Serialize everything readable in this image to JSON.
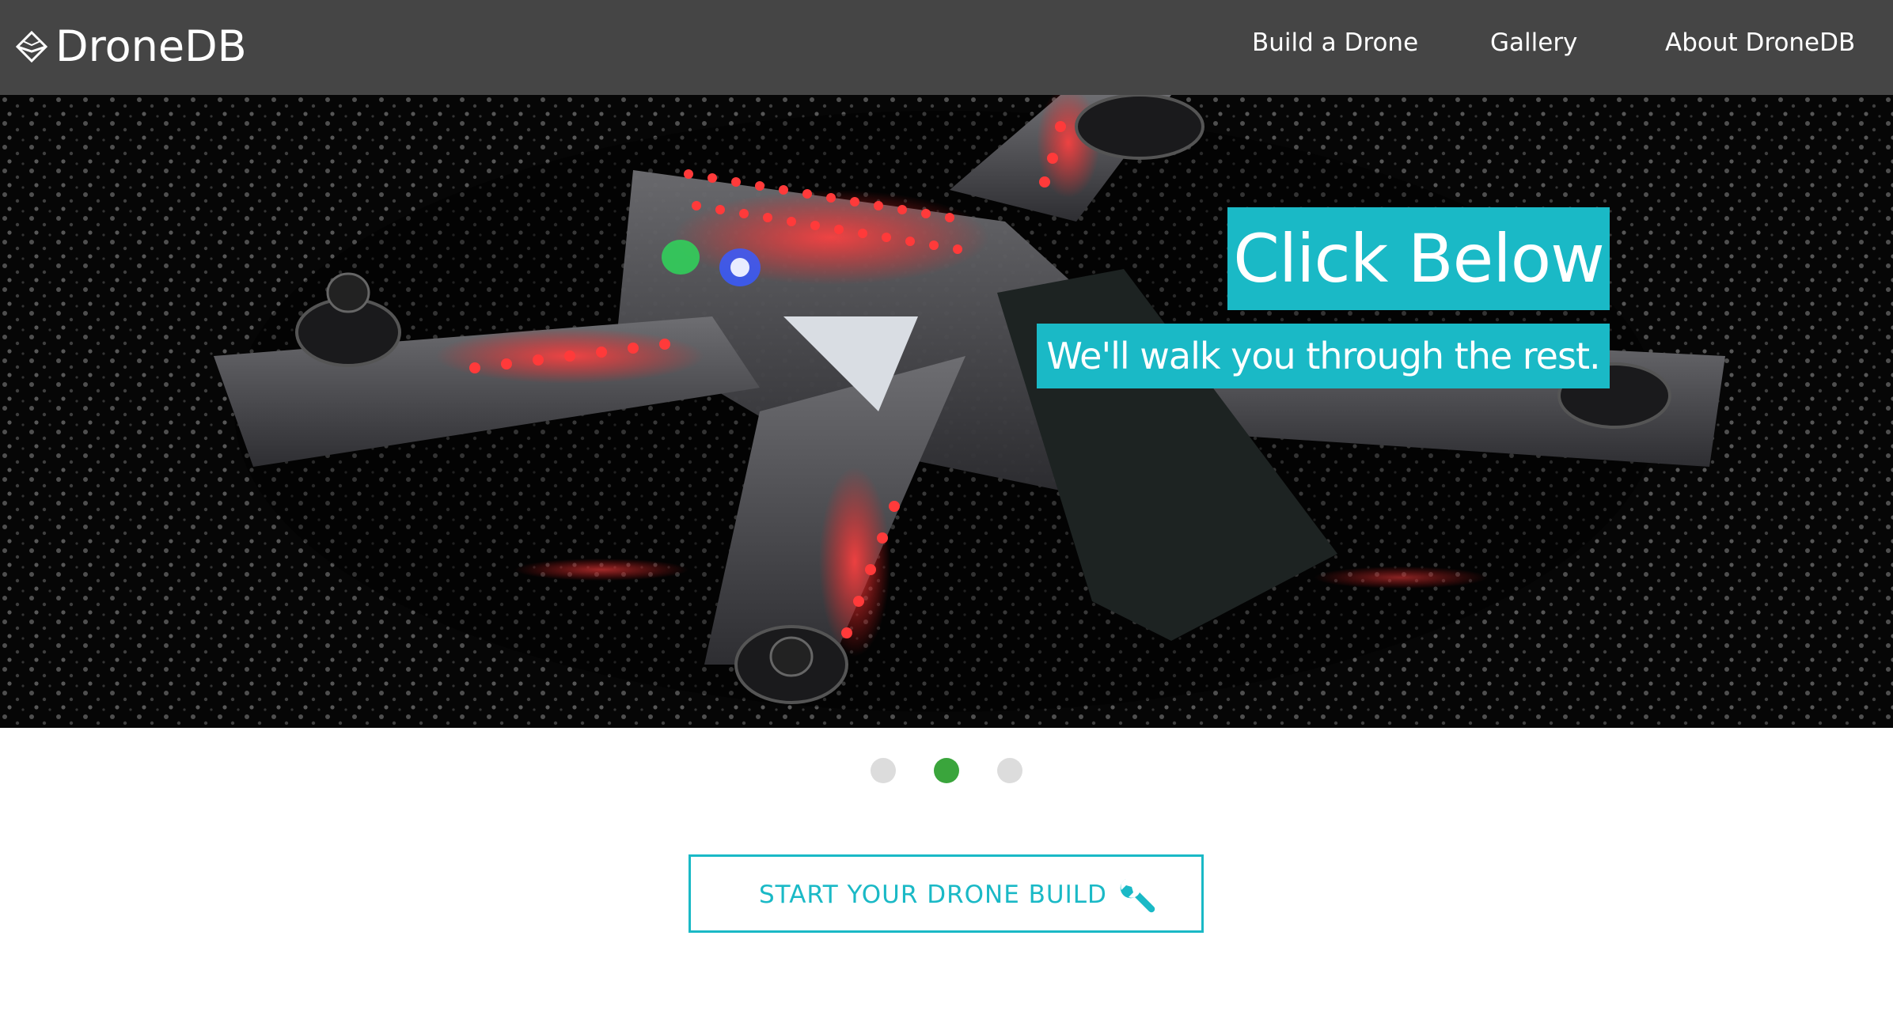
{
  "header": {
    "brand": "DroneDB",
    "nav": [
      {
        "label": "Build a Drone"
      },
      {
        "label": "Gallery"
      },
      {
        "label": "About DroneDB"
      }
    ]
  },
  "hero": {
    "title": "Click Below",
    "subtitle": "We'll walk you through the rest.",
    "image_icon": "drone-photo"
  },
  "carousel": {
    "slide_count": 3,
    "active_index": 1
  },
  "cta": {
    "label": "START YOUR DRONE BUILD",
    "icon": "wrench-icon"
  },
  "colors": {
    "header_bg": "#454545",
    "accent": "#1ab9c6",
    "dot_active": "#3aa53c",
    "dot_inactive": "#dcdcdc"
  }
}
